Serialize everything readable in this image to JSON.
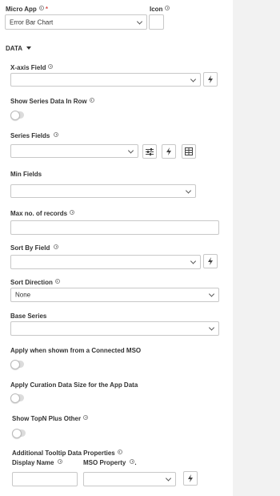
{
  "micro_app": {
    "label": "Micro App",
    "value": "Error Bar Chart"
  },
  "icon": {
    "label": "Icon"
  },
  "section": {
    "title": "DATA"
  },
  "x_axis_field": {
    "label": "X-axis Field"
  },
  "show_series_in_row": {
    "label": "Show Series Data In Row"
  },
  "series_fields": {
    "label": "Series Fields"
  },
  "min_fields": {
    "label": "Min Fields"
  },
  "max_records": {
    "label": "Max no. of records"
  },
  "sort_by_field": {
    "label": "Sort By Field"
  },
  "sort_direction": {
    "label": "Sort Direction",
    "value": "None"
  },
  "base_series": {
    "label": "Base Series"
  },
  "apply_connected_mso": {
    "label": "Apply when shown from a Connected MSO"
  },
  "apply_curation": {
    "label": "Apply Curation Data Size for the App Data"
  },
  "show_topn": {
    "label": "Show TopN Plus Other"
  },
  "tooltip": {
    "label": "Additional Tooltip Data Properties",
    "display_name_label": "Display Name",
    "mso_property_label": "MSO Property",
    "mso_property_suffix": "."
  }
}
